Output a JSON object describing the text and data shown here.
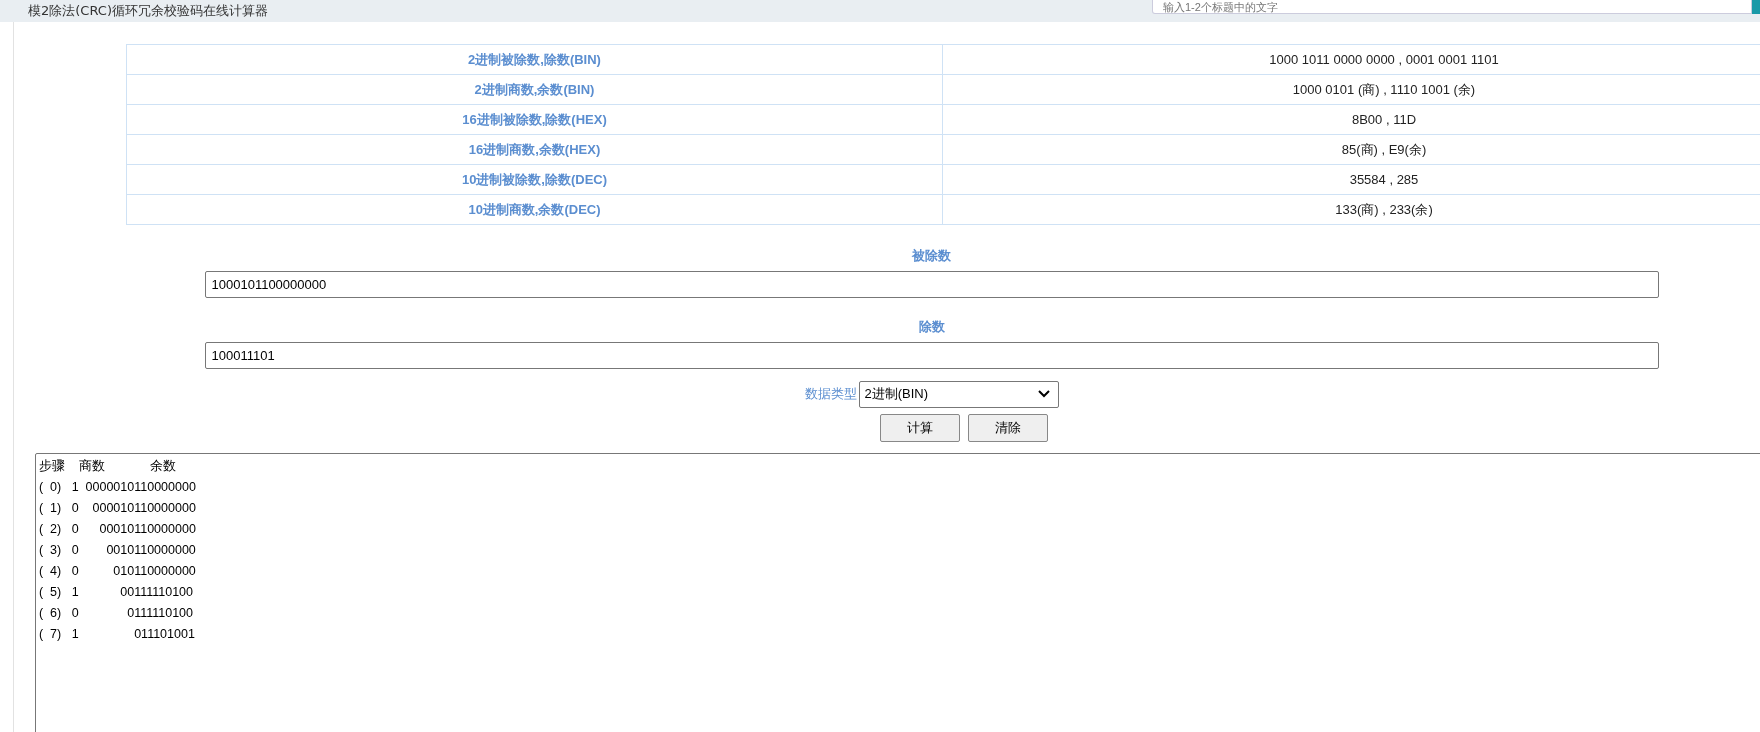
{
  "header": {
    "title": "模2除法(CRC)循环冗余校验码在线计算器",
    "search": {
      "placeholder": "输入1-2个标题中的文字"
    }
  },
  "results": [
    {
      "label": "2进制被除数,除数(BIN)",
      "value": "1000 1011 0000 0000 , 0001 0001 1101"
    },
    {
      "label": "2进制商数,余数(BIN)",
      "value": "1000 0101 (商) , 1110 1001 (余)"
    },
    {
      "label": "16进制被除数,除数(HEX)",
      "value": "8B00 , 11D"
    },
    {
      "label": "16进制商数,余数(HEX)",
      "value": "85(商) , E9(余)"
    },
    {
      "label": "10进制被除数,除数(DEC)",
      "value": "35584 , 285"
    },
    {
      "label": "10进制商数,余数(DEC)",
      "value": "133(商) , 233(余)"
    }
  ],
  "form": {
    "dividend": {
      "label": "被除数",
      "value": "1000101100000000"
    },
    "divisor": {
      "label": "除数",
      "value": "100011101"
    },
    "data_type": {
      "label": "数据类型",
      "value": "2进制(BIN)"
    },
    "buttons": [
      "计算",
      "清除"
    ]
  },
  "output": {
    "lines": [
      "步骤    商数             余数",
      "(  0)   1  0000010110000000",
      "(  1)   0    000010110000000",
      "(  2)   0      00010110000000",
      "(  3)   0        0010110000000",
      "(  4)   0          010110000000",
      "(  5)   1            00111110100",
      "(  6)   0              0111110100",
      "(  7)   1                011101001"
    ]
  }
}
